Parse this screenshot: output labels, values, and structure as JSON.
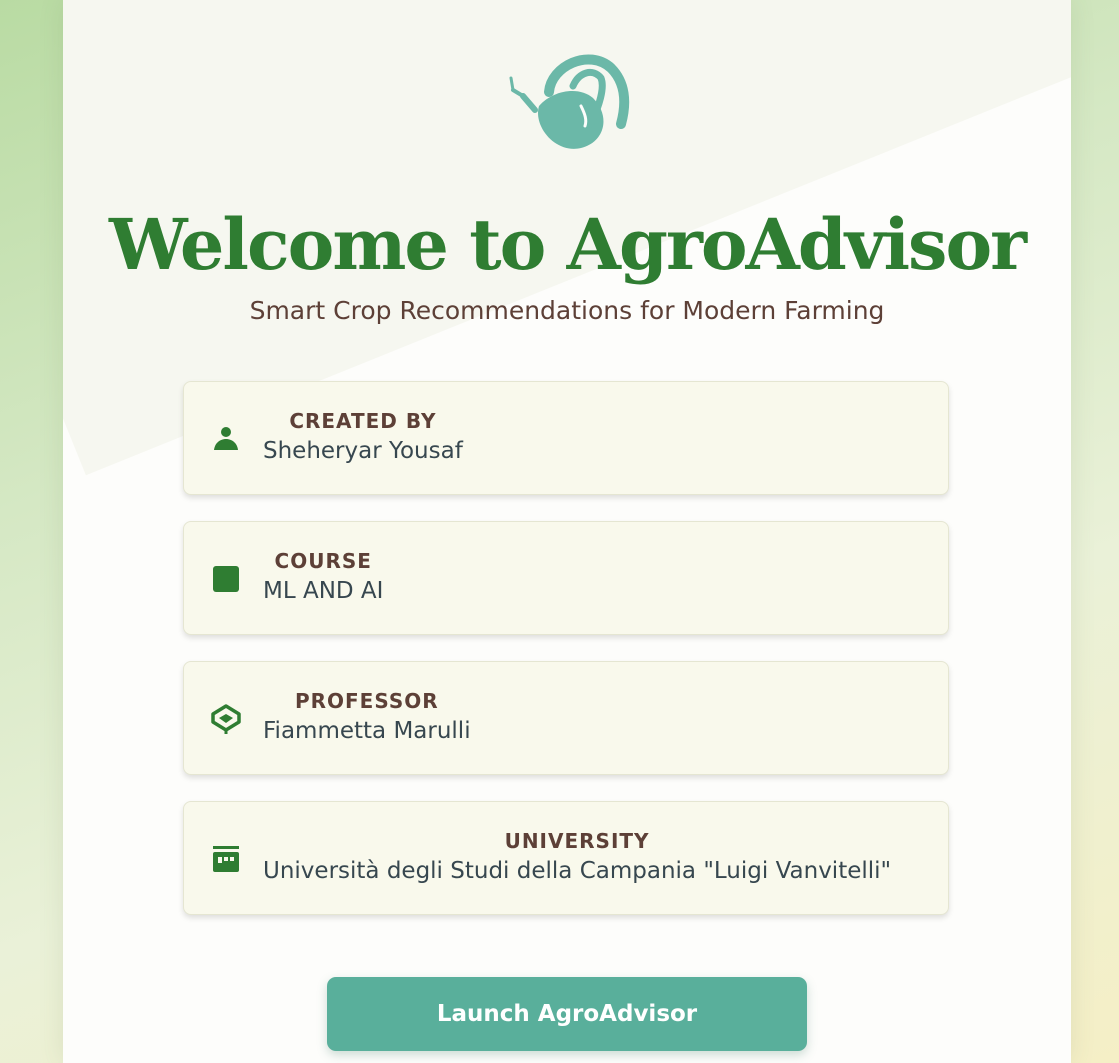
{
  "header": {
    "title": "Welcome to AgroAdvisor",
    "subtitle": "Smart Crop Recommendations for Modern Farming",
    "logo_icon": "plant-sprout-icon"
  },
  "info_cards": [
    {
      "label": "CREATED BY",
      "value": "Sheheryar Yousaf",
      "icon": "person-icon"
    },
    {
      "label": "COURSE",
      "value": "ML AND AI",
      "icon": "course-square-icon"
    },
    {
      "label": "PROFESSOR",
      "value": "Fiammetta Marulli",
      "icon": "professor-icon"
    },
    {
      "label": "UNIVERSITY",
      "value": "Università degli Studi della Campania \"Luigi Vanvitelli\"",
      "icon": "university-icon"
    }
  ],
  "actions": {
    "launch_label": "Launch AgroAdvisor"
  },
  "colors": {
    "brand_green": "#2f7d32",
    "accent_teal": "#59af9b",
    "text_brown": "#5d4037",
    "card_bg": "#f9f9ec"
  }
}
